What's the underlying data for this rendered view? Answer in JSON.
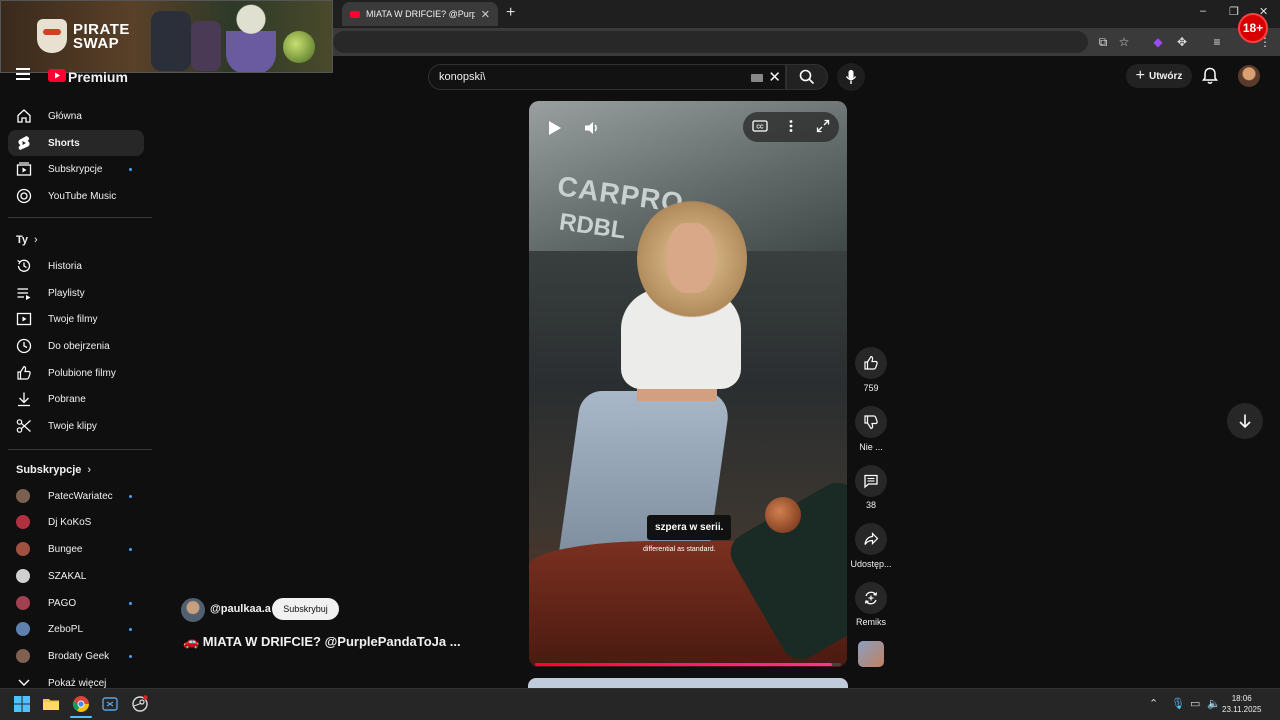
{
  "browser": {
    "tab_title": "MIATA W DRIFCIE? @Purpl",
    "new_tab": "+",
    "win_min": "–",
    "win_max": "❐",
    "win_close": "✕",
    "adult_badge": "18+"
  },
  "ad": {
    "brand_line1": "PIRATE",
    "brand_line2": "SWAP"
  },
  "header": {
    "logo_text": "Premium",
    "search_value": "konopski\\",
    "clear": "✕",
    "create_label": "Utwórz"
  },
  "sidebar": {
    "main": [
      {
        "label": "Główna",
        "icon": "home-icon"
      },
      {
        "label": "Shorts",
        "icon": "shorts-icon",
        "active": true
      },
      {
        "label": "Subskrypcje",
        "icon": "subscriptions-icon",
        "dot": true
      },
      {
        "label": "YouTube Music",
        "icon": "music-icon"
      }
    ],
    "you_header": "Ty",
    "you": [
      {
        "label": "Historia",
        "icon": "history-icon"
      },
      {
        "label": "Playlisty",
        "icon": "playlists-icon"
      },
      {
        "label": "Twoje filmy",
        "icon": "your-videos-icon"
      },
      {
        "label": "Do obejrzenia",
        "icon": "watch-later-icon"
      },
      {
        "label": "Polubione filmy",
        "icon": "liked-icon"
      },
      {
        "label": "Pobrane",
        "icon": "download-icon"
      },
      {
        "label": "Twoje klipy",
        "icon": "clips-icon"
      }
    ],
    "subs_header": "Subskrypcje",
    "subs": [
      {
        "label": "PatecWariatec",
        "dot": true,
        "color": "#7a6050"
      },
      {
        "label": "Dj KoKoS",
        "dot": false,
        "color": "#b03040"
      },
      {
        "label": "Bungee",
        "dot": true,
        "color": "#a05040"
      },
      {
        "label": "SZAKAL",
        "dot": false,
        "color": "#d0d0d0"
      },
      {
        "label": "PAGO",
        "dot": true,
        "color": "#a04050"
      },
      {
        "label": "ZeboPL",
        "dot": true,
        "color": "#6080b0"
      },
      {
        "label": "Brodaty Geek",
        "dot": true,
        "color": "#806050"
      }
    ],
    "show_more": "Pokaż więcej"
  },
  "video": {
    "sign_line1": "CARPRO",
    "sign_line2": "RDBL",
    "caption_main": "szpera w serii.",
    "caption_sub": "differential as standard.",
    "progress": 0.97
  },
  "actions": {
    "likes": "759",
    "dislike": "Nie ...",
    "comments": "38",
    "share": "Udostęp...",
    "remix": "Remiks"
  },
  "channel": {
    "name": "@paulkaa.a",
    "subscribe": "Subskrybuj",
    "title": "🚗 MIATA W DRIFCIE? @PurplePandaToJa ..."
  },
  "taskbar": {
    "time": "18:06",
    "date": "23.11.2025"
  },
  "colors": {
    "accent": "#ff0033",
    "bg": "#0f0f0f",
    "surface": "#272727"
  }
}
